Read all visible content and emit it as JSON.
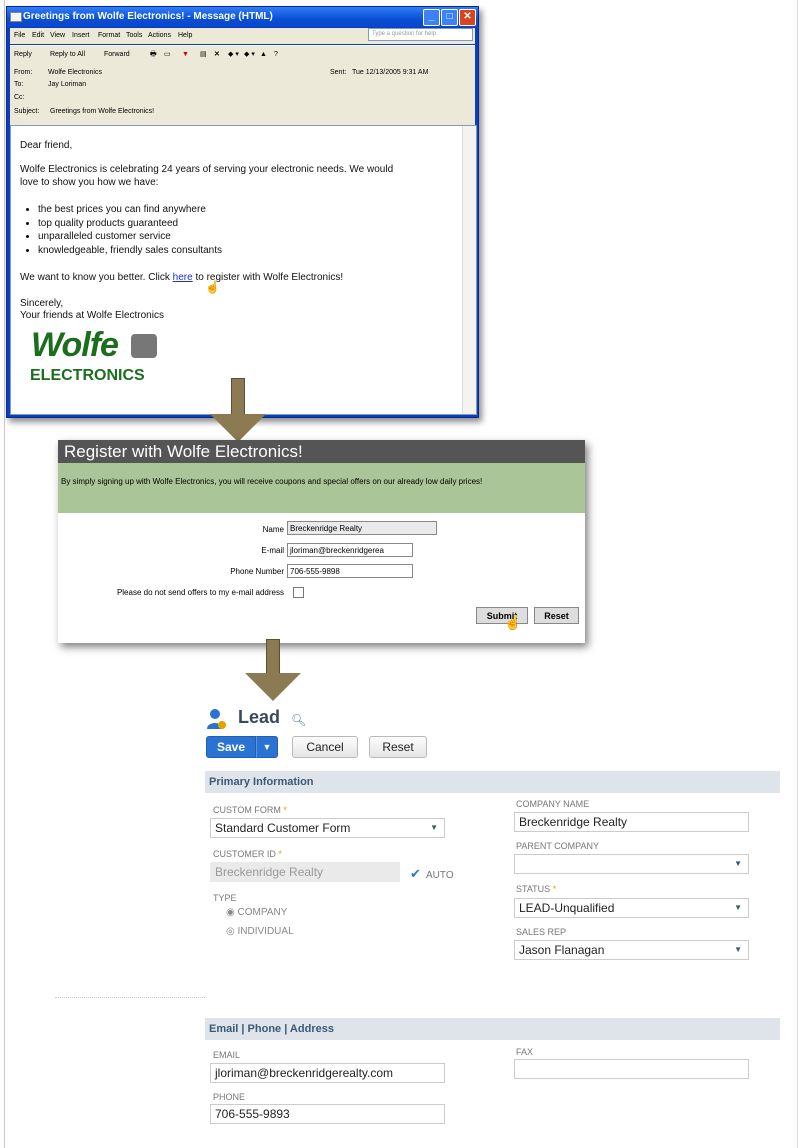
{
  "outlook": {
    "window_title": "Greetings from Wolfe Electronics! - Message (HTML)",
    "menu": [
      "File",
      "Edit",
      "View",
      "Insert",
      "Format",
      "Tools",
      "Actions",
      "Help"
    ],
    "help_placeholder": "Type a question for help",
    "toolbar": {
      "reply": "Reply",
      "reply_all": "Reply to All",
      "forward": "Forward"
    },
    "header": {
      "from_label": "From:",
      "from": "Wolfe Electronics",
      "to_label": "To:",
      "to": "Jay Loriman",
      "cc_label": "Cc:",
      "subject_label": "Subject:",
      "subject": "Greetings from Wolfe Electronics!",
      "sent_label": "Sent:",
      "sent": "Tue 12/13/2005 9:31 AM"
    },
    "body": {
      "greeting": "Dear friend,",
      "intro_1": "Wolfe Electronics is celebrating 24 years of serving your electronic needs. We would",
      "intro_2": "love to show you how we have:",
      "bullets": [
        "the best prices you can find anywhere",
        "top quality products guaranteed",
        "unparalleled customer service",
        "knowledgeable, friendly sales consultants"
      ],
      "cta_before": "We want to know you better. Click ",
      "cta_link": "here",
      "cta_after": " to register with Wolfe Electronics!",
      "signoff": "Sincerely,",
      "signature": "Your friends at Wolfe Electronics",
      "logo_top": "Wolfe",
      "logo_bottom": "ELECTRONICS"
    }
  },
  "registration": {
    "title": "Register with Wolfe Electronics!",
    "intro": "By simply signing up with Wolfe Electronics, you will receive coupons and special offers on our already low daily prices!",
    "name_label": "Name",
    "name_value": "Breckenridge Realty",
    "email_label": "E-mail",
    "email_value": "jloriman@breckenridgerea",
    "phone_label": "Phone Number",
    "phone_value": "706-555-9898",
    "optout_label": "Please do not send offers to my e-mail address",
    "submit": "Submit",
    "reset": "Reset"
  },
  "lead": {
    "title": "Lead",
    "buttons": {
      "save": "Save",
      "cancel": "Cancel",
      "reset": "Reset"
    },
    "primary_section": "Primary Information",
    "custom_form_label": "CUSTOM FORM",
    "custom_form": "Standard Customer Form",
    "customer_id_label": "CUSTOMER ID",
    "customer_id": "Breckenridge Realty",
    "auto_label": "AUTO",
    "type_label": "TYPE",
    "type_company": "COMPANY",
    "type_individual": "INDIVIDUAL",
    "company_name_label": "COMPANY NAME",
    "company_name": "Breckenridge Realty",
    "parent_company_label": "PARENT COMPANY",
    "parent_company": "",
    "status_label": "STATUS",
    "status": "LEAD-Unqualified",
    "sales_rep_label": "SALES REP",
    "sales_rep": "Jason Flanagan",
    "contact_section": "Email | Phone | Address",
    "email_label": "EMAIL",
    "email": "jloriman@breckenridgerealty.com",
    "phone_label": "PHONE",
    "phone": "706-555-9893",
    "fax_label": "FAX",
    "fax": ""
  },
  "colors": {
    "accent": "#2b73d2",
    "register_band": "#aac597",
    "arrow": "#8c7b52",
    "logo": "#1b6e1d"
  }
}
